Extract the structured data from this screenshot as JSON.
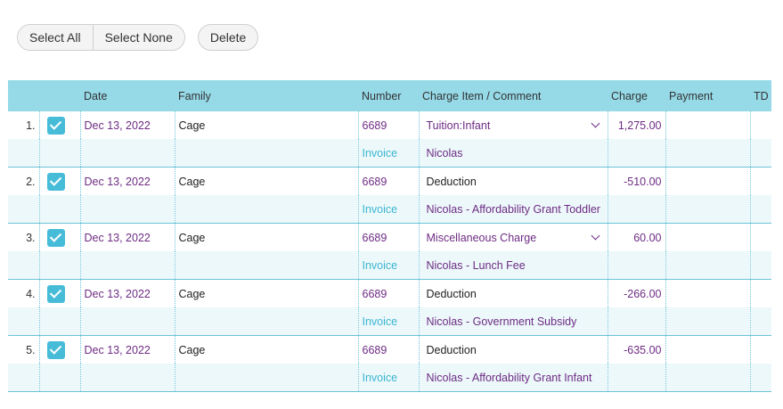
{
  "toolbar": {
    "select_all": "Select All",
    "select_none": "Select None",
    "delete": "Delete"
  },
  "table": {
    "headers": [
      "",
      "",
      "Date",
      "Family",
      "Number",
      "Charge Item / Comment",
      "Charge",
      "Payment",
      "TD"
    ],
    "rows": [
      {
        "index": "1.",
        "checked": true,
        "date": "Dec 13, 2022",
        "family": "Cage",
        "number": "6689",
        "item": "Tuition:Infant",
        "item_dropdown": true,
        "charge": "1,275.00",
        "payment": "",
        "td": "",
        "type": "Invoice",
        "comment": "Nicolas"
      },
      {
        "index": "2.",
        "checked": true,
        "date": "Dec 13, 2022",
        "family": "Cage",
        "number": "6689",
        "item": "Deduction",
        "item_dropdown": false,
        "charge": "-510.00",
        "payment": "",
        "td": "",
        "type": "Invoice",
        "comment": "Nicolas - Affordability Grant Toddler"
      },
      {
        "index": "3.",
        "checked": true,
        "date": "Dec 13, 2022",
        "family": "Cage",
        "number": "6689",
        "item": "Miscellaneous Charge",
        "item_dropdown": true,
        "charge": "60.00",
        "payment": "",
        "td": "",
        "type": "Invoice",
        "comment": "Nicolas - Lunch Fee"
      },
      {
        "index": "4.",
        "checked": true,
        "date": "Dec 13, 2022",
        "family": "Cage",
        "number": "6689",
        "item": "Deduction",
        "item_dropdown": false,
        "charge": "-266.00",
        "payment": "",
        "td": "",
        "type": "Invoice",
        "comment": "Nicolas - Government Subsidy"
      },
      {
        "index": "5.",
        "checked": true,
        "date": "Dec 13, 2022",
        "family": "Cage",
        "number": "6689",
        "item": "Deduction",
        "item_dropdown": false,
        "charge": "-635.00",
        "payment": "",
        "td": "",
        "type": "Invoice",
        "comment": "Nicolas - Affordability Grant Infant"
      }
    ]
  },
  "colors": {
    "header_bg": "#96dae8",
    "checkbox": "#47bcd8",
    "link_purple": "#6d2c83",
    "link_teal": "#3ab7cf",
    "sub_row_bg": "#edf8fb"
  }
}
